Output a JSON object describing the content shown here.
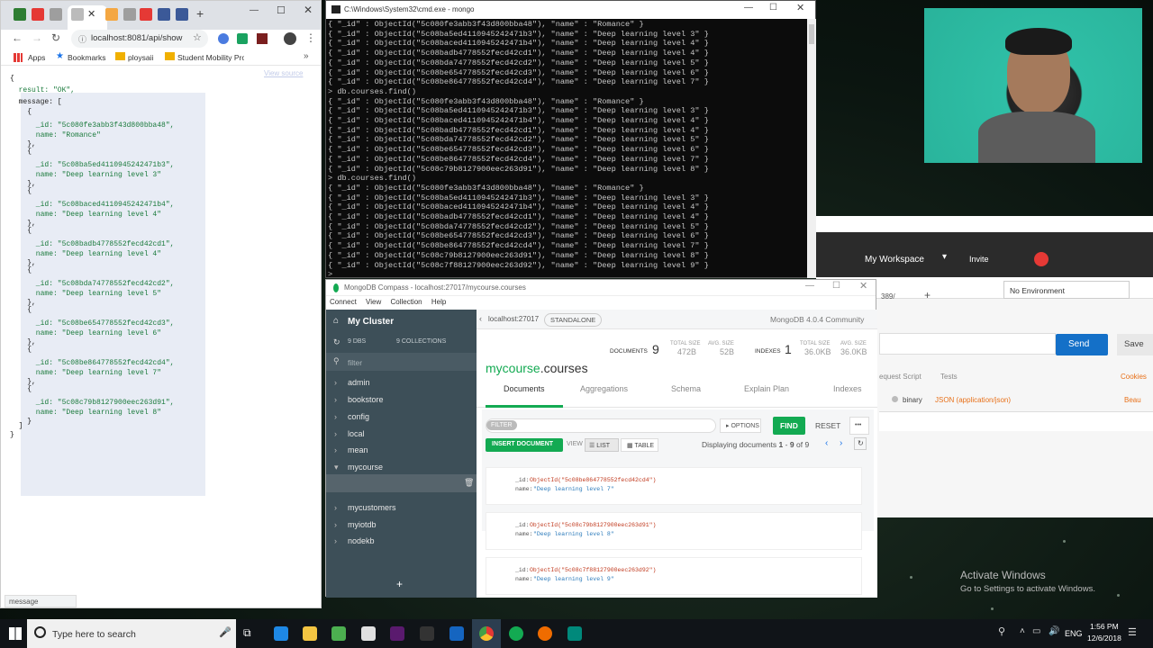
{
  "chrome": {
    "url": "localhost:8081/api/show",
    "bookmarks": [
      "Apps",
      "Bookmarks",
      "ploysaii",
      "Student Mobility Pro"
    ],
    "view_source": "View source",
    "status": "message",
    "json_lines": [
      "{",
      "  result: \"OK\",",
      "  message: [",
      "    {",
      "      _id: \"5c080fe3abb3f43d800bba48\",",
      "      name: \"Romance\"",
      "    },",
      "    {",
      "      _id: \"5c08ba5ed4110945242471b3\",",
      "      name: \"Deep learning level 3\"",
      "    },",
      "    {",
      "      _id: \"5c08baced4110945242471b4\",",
      "      name: \"Deep learning level 4\"",
      "    },",
      "    {",
      "      _id: \"5c08badb4778552fecd42cd1\",",
      "      name: \"Deep learning level 4\"",
      "    },",
      "    {",
      "      _id: \"5c08bda74778552fecd42cd2\",",
      "      name: \"Deep learning level 5\"",
      "    },",
      "    {",
      "      _id: \"5c08be654778552fecd42cd3\",",
      "      name: \"Deep learning level 6\"",
      "    },",
      "    {",
      "      _id: \"5c08be864778552fecd42cd4\",",
      "      name: \"Deep learning level 7\"",
      "    },",
      "    {",
      "      _id: \"5c08c79b8127900eec263d91\",",
      "      name: \"Deep learning level 8\"",
      "    }",
      "  ]",
      "}"
    ]
  },
  "cmd": {
    "title": "C:\\Windows\\System32\\cmd.exe - mongo",
    "text": "{ \"_id\" : ObjectId(\"5c080fe3abb3f43d800bba48\"), \"name\" : \"Romance\" }\n{ \"_id\" : ObjectId(\"5c08ba5ed4110945242471b3\"), \"name\" : \"Deep learning level 3\" }\n{ \"_id\" : ObjectId(\"5c08baced4110945242471b4\"), \"name\" : \"Deep learning level 4\" }\n{ \"_id\" : ObjectId(\"5c08badb4778552fecd42cd1\"), \"name\" : \"Deep learning level 4\" }\n{ \"_id\" : ObjectId(\"5c08bda74778552fecd42cd2\"), \"name\" : \"Deep learning level 5\" }\n{ \"_id\" : ObjectId(\"5c08be654778552fecd42cd3\"), \"name\" : \"Deep learning level 6\" }\n{ \"_id\" : ObjectId(\"5c08be864778552fecd42cd4\"), \"name\" : \"Deep learning level 7\" }\n> db.courses.find()\n{ \"_id\" : ObjectId(\"5c080fe3abb3f43d800bba48\"), \"name\" : \"Romance\" }\n{ \"_id\" : ObjectId(\"5c08ba5ed4110945242471b3\"), \"name\" : \"Deep learning level 3\" }\n{ \"_id\" : ObjectId(\"5c08baced4110945242471b4\"), \"name\" : \"Deep learning level 4\" }\n{ \"_id\" : ObjectId(\"5c08badb4778552fecd42cd1\"), \"name\" : \"Deep learning level 4\" }\n{ \"_id\" : ObjectId(\"5c08bda74778552fecd42cd2\"), \"name\" : \"Deep learning level 5\" }\n{ \"_id\" : ObjectId(\"5c08be654778552fecd42cd3\"), \"name\" : \"Deep learning level 6\" }\n{ \"_id\" : ObjectId(\"5c08be864778552fecd42cd4\"), \"name\" : \"Deep learning level 7\" }\n{ \"_id\" : ObjectId(\"5c08c79b8127900eec263d91\"), \"name\" : \"Deep learning level 8\" }\n> db.courses.find()\n{ \"_id\" : ObjectId(\"5c080fe3abb3f43d800bba48\"), \"name\" : \"Romance\" }\n{ \"_id\" : ObjectId(\"5c08ba5ed4110945242471b3\"), \"name\" : \"Deep learning level 3\" }\n{ \"_id\" : ObjectId(\"5c08baced4110945242471b4\"), \"name\" : \"Deep learning level 4\" }\n{ \"_id\" : ObjectId(\"5c08badb4778552fecd42cd1\"), \"name\" : \"Deep learning level 4\" }\n{ \"_id\" : ObjectId(\"5c08bda74778552fecd42cd2\"), \"name\" : \"Deep learning level 5\" }\n{ \"_id\" : ObjectId(\"5c08be654778552fecd42cd3\"), \"name\" : \"Deep learning level 6\" }\n{ \"_id\" : ObjectId(\"5c08be864778552fecd42cd4\"), \"name\" : \"Deep learning level 7\" }\n{ \"_id\" : ObjectId(\"5c08c79b8127900eec263d91\"), \"name\" : \"Deep learning level 8\" }\n{ \"_id\" : ObjectId(\"5c08c7f88127900eec263d92\"), \"name\" : \"Deep learning level 9\" }\n>"
  },
  "compass": {
    "title": "MongoDB Compass - localhost:27017/mycourse.courses",
    "menu": [
      "Connect",
      "View",
      "Collection",
      "Help"
    ],
    "cluster": "My Cluster",
    "dbs": "9 DBS",
    "collections": "9 COLLECTIONS",
    "filter_placeholder": "filter",
    "databases": [
      "admin",
      "bookstore",
      "config",
      "local",
      "mean",
      "mycourse",
      "courses",
      "mycustomers",
      "myiotdb",
      "nodekb"
    ],
    "host": "localhost:27017",
    "standalone": "STANDALONE",
    "version": "MongoDB 4.0.4 Community",
    "documents_label": "DOCUMENTS",
    "documents_count": "9",
    "total_size_label": "TOTAL SIZE",
    "total_size": "472B",
    "avg_size_label": "AVG. SIZE",
    "avg_size": "52B",
    "indexes_label": "INDEXES",
    "indexes_count": "1",
    "idx_total_size": "36.0KB",
    "idx_avg_size": "36.0KB",
    "ns_db": "mycourse",
    "ns_coll": ".courses",
    "tabs": [
      "Documents",
      "Aggregations",
      "Schema",
      "Explain Plan",
      "Indexes"
    ],
    "filter_chip": "FILTER",
    "options": "OPTIONS",
    "find": "FIND",
    "reset": "RESET",
    "more": "•••",
    "insert": "INSERT DOCUMENT",
    "view_label": "VIEW",
    "list": "LIST",
    "table": "TABLE",
    "displaying": "Displaying documents",
    "range_start": "1",
    "range_sep": "-",
    "range_end": "9",
    "of": "of",
    "total": "9",
    "docs": [
      {
        "id": "ObjectId(\"5c08be864778552fecd42cd4\")",
        "name": "\"Deep learning level 7\""
      },
      {
        "id": "ObjectId(\"5c08c79b8127900eec263d91\")",
        "name": "\"Deep learning level 8\""
      },
      {
        "id": "ObjectId(\"5c08c7f88127900eec263d92\")",
        "name": "\"Deep learning level 9\""
      }
    ],
    "id_key": "_id:",
    "name_key": "name:"
  },
  "postman": {
    "workspace": "My Workspace",
    "invite": "Invite",
    "environment": "No Environment",
    "send": "Send",
    "save": "Save",
    "request_script": "equest Script",
    "tests": "Tests",
    "cookies": "Cookies",
    "binary": "binary",
    "content_type": "JSON (application/json)",
    "beau": "Beau",
    "tab_fragment": "389/"
  },
  "activate": {
    "title": "Activate Windows",
    "subtitle": "Go to Settings to activate Windows."
  },
  "taskbar": {
    "search_placeholder": "Type here to search",
    "lang": "ENG",
    "time": "1:56 PM",
    "date": "12/6/2018"
  }
}
